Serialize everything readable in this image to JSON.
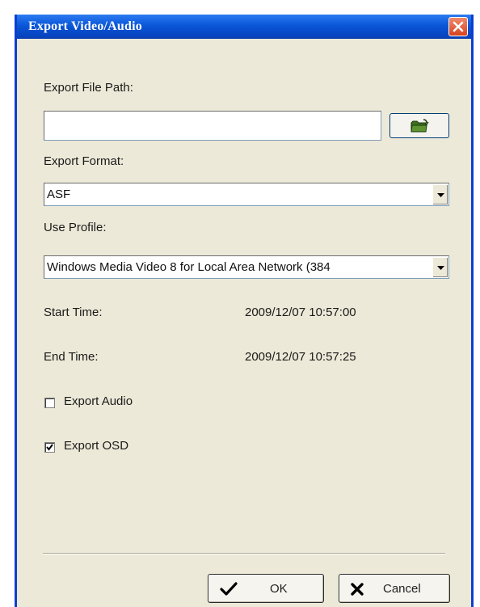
{
  "window": {
    "title": "Export Video/Audio"
  },
  "form": {
    "file_path_label": "Export File Path:",
    "file_path_value": "",
    "export_format_label": "Export Format:",
    "export_format_value": "ASF",
    "use_profile_label": "Use Profile:",
    "use_profile_value": "Windows Media Video 8 for Local Area Network (384",
    "start_time_label": "Start Time:",
    "start_time_value": "2009/12/07 10:57:00",
    "end_time_label": "End Time:",
    "end_time_value": "2009/12/07 10:57:25",
    "export_audio_label": "Export Audio",
    "export_audio_checked": false,
    "export_osd_label": "Export OSD",
    "export_osd_checked": true
  },
  "buttons": {
    "ok_label": "OK",
    "cancel_label": "Cancel"
  },
  "icons": {
    "close": "close-icon",
    "browse": "open-folder-icon",
    "dropdown": "chevron-down-icon",
    "ok": "checkmark-icon",
    "cancel": "x-icon",
    "check": "checkmark-icon"
  },
  "colors": {
    "titlebar": "#0a56d8",
    "close_button": "#d8431f",
    "dialog_background": "#ece9d8"
  }
}
